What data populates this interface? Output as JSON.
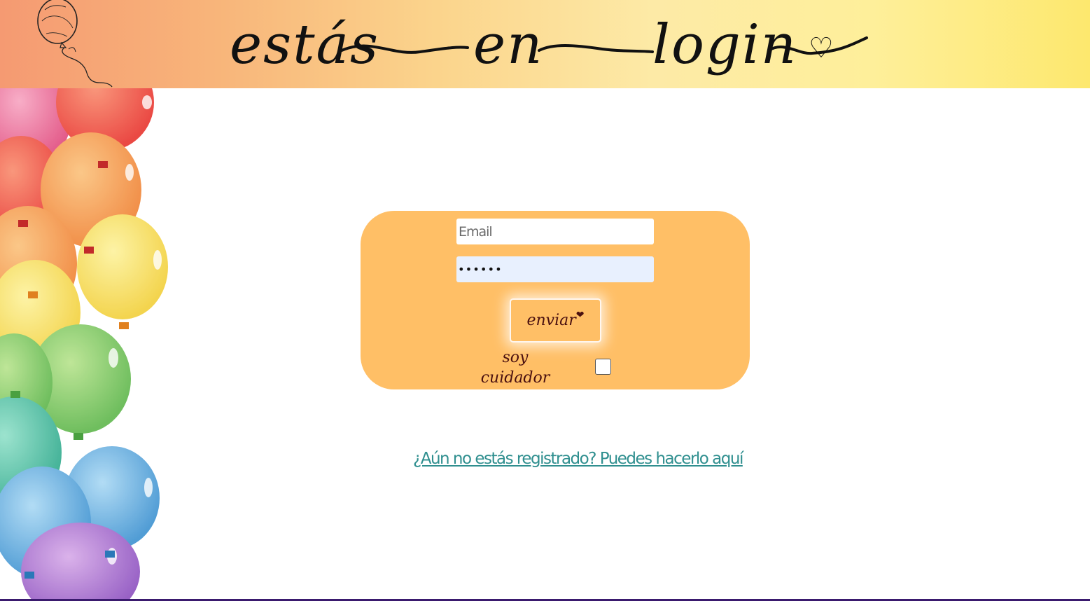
{
  "header": {
    "title_words": [
      "estás",
      "en",
      "login"
    ],
    "title_heart": "♡"
  },
  "login_form": {
    "email_placeholder": "Email",
    "password_value": "••••••",
    "submit_label": "enviar",
    "submit_heart": "❤",
    "caregiver_label": "soy cuidador",
    "caregiver_checked": false
  },
  "register_link": {
    "text": "¿Aún no estás registrado? Puedes hacerlo aquí"
  },
  "colors": {
    "card_bg": "#ffbf66",
    "link": "#2f8f8f",
    "button_text": "#4a1010",
    "header_left": "#f59a72",
    "header_right": "#fde86e"
  },
  "icons": [
    "balloon-sketch-icon",
    "heart-icon",
    "balloons-decoration"
  ]
}
